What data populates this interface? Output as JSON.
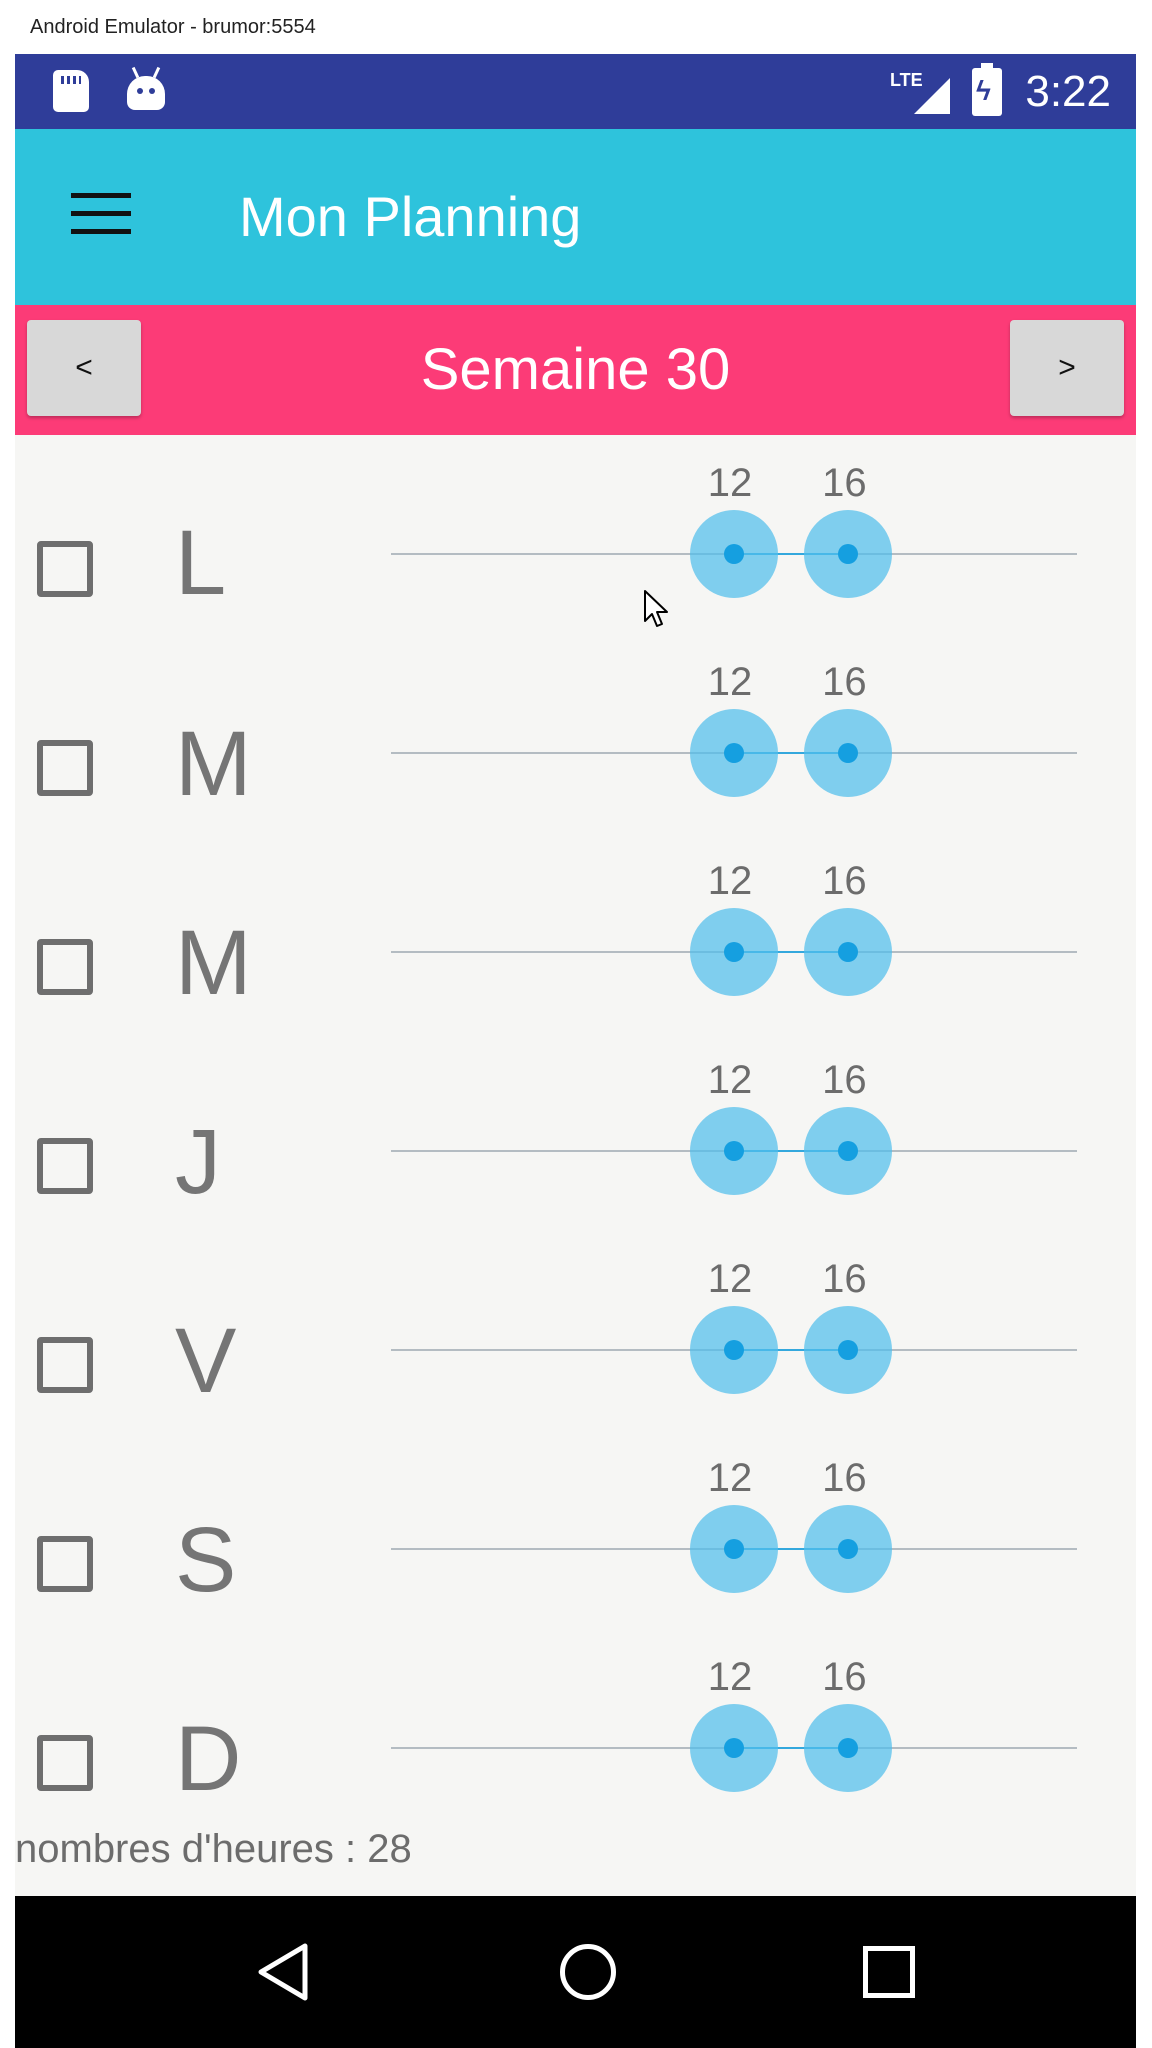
{
  "window": {
    "title": "Android Emulator - brumor:5554"
  },
  "status_bar": {
    "time": "3:22",
    "network": "LTE",
    "icons": [
      "sd-card-icon",
      "android-icon",
      "lte-signal-icon",
      "battery-charging-icon"
    ]
  },
  "app_bar": {
    "title": "Mon Planning",
    "menu_icon": "hamburger-menu-icon"
  },
  "week_nav": {
    "prev_label": "<",
    "title": "Semaine 30",
    "next_label": ">"
  },
  "slider_scale": {
    "min": 0,
    "max": 24
  },
  "days": [
    {
      "letter": "L",
      "checked": false,
      "start": "12",
      "end": "16"
    },
    {
      "letter": "M",
      "checked": false,
      "start": "12",
      "end": "16"
    },
    {
      "letter": "M",
      "checked": false,
      "start": "12",
      "end": "16"
    },
    {
      "letter": "J",
      "checked": false,
      "start": "12",
      "end": "16"
    },
    {
      "letter": "V",
      "checked": false,
      "start": "12",
      "end": "16"
    },
    {
      "letter": "S",
      "checked": false,
      "start": "12",
      "end": "16"
    },
    {
      "letter": "D",
      "checked": false,
      "start": "12",
      "end": "16"
    }
  ],
  "summary": {
    "hours_label": "nombres d'heures : 28"
  },
  "colors": {
    "status_bar": "#2f3d99",
    "app_bar": "#2ec3dc",
    "week_bar": "#fc3b77",
    "thumb": "#50beeb",
    "thumb_center": "#159fe0",
    "nav_bar": "#000000"
  },
  "nav_bar": {
    "icons": [
      "back-icon",
      "home-icon",
      "recents-icon"
    ]
  }
}
